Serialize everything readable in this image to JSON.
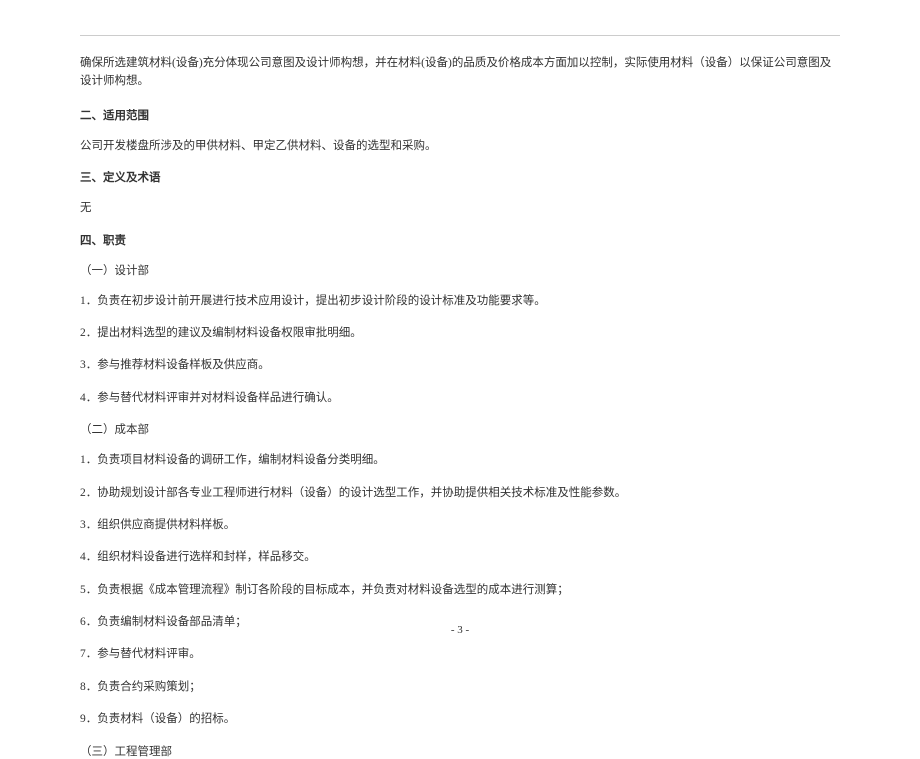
{
  "intro": "确保所选建筑材料(设备)充分体现公司意图及设计师构想，并在材料(设备)的品质及价格成本方面加以控制，实际使用材料（设备）以保证公司意图及设计师构想。",
  "section_scope_heading": "二、适用范围",
  "section_scope_body": "公司开发楼盘所涉及的甲供材料、甲定乙供材料、设备的选型和采购。",
  "section_def_heading": "三、定义及术语",
  "section_def_body": "无",
  "section_resp_heading": "四、职责",
  "dept1_heading": "（一）设计部",
  "dept1_item1": "1．负责在初步设计前开展进行技术应用设计，提出初步设计阶段的设计标准及功能要求等。",
  "dept1_item2": "2．提出材料选型的建议及编制材料设备权限审批明细。",
  "dept1_item3": "3．参与推荐材料设备样板及供应商。",
  "dept1_item4": "4．参与替代材料评审并对材料设备样品进行确认。",
  "dept2_heading": "（二）成本部",
  "dept2_item1": "1．负责项目材料设备的调研工作，编制材料设备分类明细。",
  "dept2_item2": "2．协助规划设计部各专业工程师进行材料（设备）的设计选型工作，并协助提供相关技术标准及性能参数。",
  "dept2_item3": "3．组织供应商提供材料样板。",
  "dept2_item4": "4．组织材料设备进行选样和封样，样品移交。",
  "dept2_item5": "5．负责根据《成本管理流程》制订各阶段的目标成本，并负责对材料设备选型的成本进行测算；",
  "dept2_item6": "6．负责编制材料设备部品清单；",
  "dept2_item7": "7．参与替代材料评审。",
  "dept2_item8": "8．负责合约采购策划；",
  "dept2_item9": "9．负责材料（设备）的招标。",
  "dept3_heading": "（三）工程管理部",
  "page_number": "- 3 -"
}
